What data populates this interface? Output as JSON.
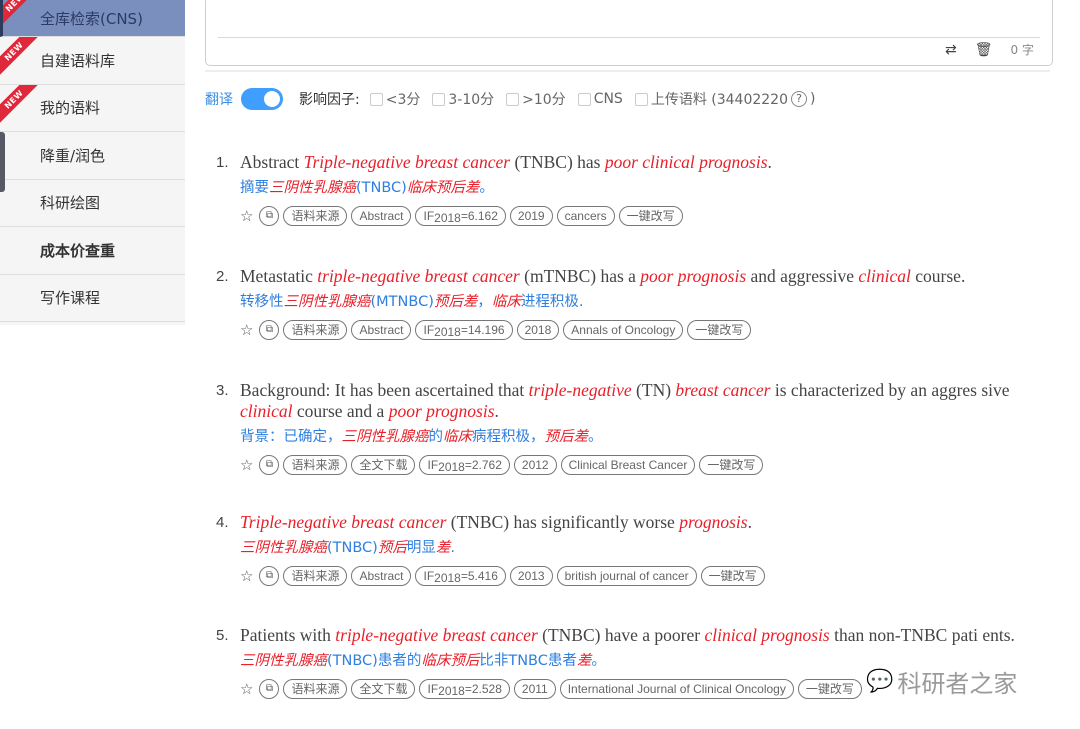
{
  "sidebar": {
    "items": [
      {
        "label": "全库检索(CNS)",
        "badge": "NEW",
        "active": true
      },
      {
        "label": "自建语料库",
        "badge": "NEW"
      },
      {
        "label": "我的语料",
        "badge": "NEW"
      },
      {
        "label": "降重/润色"
      },
      {
        "label": "科研绘图"
      },
      {
        "label": "成本价查重",
        "bold": true
      },
      {
        "label": "写作课程"
      }
    ]
  },
  "input": {
    "char_count": "0 字",
    "icons": [
      "swap-icon",
      "trash-icon"
    ]
  },
  "filter": {
    "translate_label": "翻译",
    "translate_on": true,
    "impact_factor_label": "影响因子:",
    "options": [
      {
        "label": "<3分",
        "checked": false
      },
      {
        "label": "3-10分",
        "checked": false
      },
      {
        "label": ">10分",
        "checked": false
      },
      {
        "label": "CNS",
        "checked": false
      },
      {
        "label": "上传语料 (34402220",
        "checked": false
      }
    ],
    "help_glyph": "?",
    "close_paren": ")"
  },
  "results": [
    {
      "num": "1.",
      "en": [
        {
          "t": "Abstract "
        },
        {
          "t": "Triple-negative breast cancer",
          "hl": true
        },
        {
          "t": " (TNBC) has "
        },
        {
          "t": "poor clinical prognosis",
          "hl": true
        },
        {
          "t": "."
        }
      ],
      "zh": [
        {
          "t": "摘要"
        },
        {
          "t": "三阴性乳腺癌",
          "hl": true
        },
        {
          "t": "(TNBC)"
        },
        {
          "t": "临床预后差",
          "hl": true
        },
        {
          "t": "。"
        }
      ],
      "tags": [
        "语料来源",
        "Abstract",
        "IF|2018|=6.162",
        "2019",
        "cancers",
        "一键改写"
      ]
    },
    {
      "num": "2.",
      "en": [
        {
          "t": "Metastatic "
        },
        {
          "t": "triple-negative breast cancer",
          "hl": true
        },
        {
          "t": " (mTNBC) has a "
        },
        {
          "t": "poor prognosis",
          "hl": true
        },
        {
          "t": " and aggressive "
        },
        {
          "t": "clinical",
          "hl": true
        },
        {
          "t": " course."
        }
      ],
      "zh": [
        {
          "t": "转移性"
        },
        {
          "t": "三阴性乳腺癌",
          "hl": true
        },
        {
          "t": "(MTNBC)"
        },
        {
          "t": "预后差",
          "hl": true
        },
        {
          "t": "，"
        },
        {
          "t": "临床",
          "hl": true
        },
        {
          "t": "进程积极."
        }
      ],
      "tags": [
        "语料来源",
        "Abstract",
        "IF|2018|=14.196",
        "2018",
        "Annals of Oncology",
        "一键改写"
      ]
    },
    {
      "num": "3.",
      "en": [
        {
          "t": "Background: It has been ascertained that "
        },
        {
          "t": "triple-negative",
          "hl": true
        },
        {
          "t": " (TN) "
        },
        {
          "t": "breast cancer",
          "hl": true
        },
        {
          "t": " is characterized by an aggres sive "
        },
        {
          "t": "clinical",
          "hl": true
        },
        {
          "t": " course and a "
        },
        {
          "t": "poor prognosis",
          "hl": true
        },
        {
          "t": "."
        }
      ],
      "zh": [
        {
          "t": "背景：已确定，"
        },
        {
          "t": "三阴性乳腺癌",
          "hl": true
        },
        {
          "t": "的"
        },
        {
          "t": "临床",
          "hl": true
        },
        {
          "t": "病程积极，"
        },
        {
          "t": "预后差",
          "hl": true
        },
        {
          "t": "。"
        }
      ],
      "tags": [
        "语料来源",
        "全文下载",
        "IF|2018|=2.762",
        "2012",
        "Clinical Breast Cancer",
        "一键改写"
      ]
    },
    {
      "num": "4.",
      "en": [
        {
          "t": "Triple-negative breast cancer",
          "hl": true
        },
        {
          "t": " (TNBC) has significantly worse "
        },
        {
          "t": "prognosis",
          "hl": true
        },
        {
          "t": "."
        }
      ],
      "zh": [
        {
          "t": "三阴性乳腺癌",
          "hl": true
        },
        {
          "t": "(TNBC)"
        },
        {
          "t": "预后",
          "hl": true
        },
        {
          "t": "明显"
        },
        {
          "t": "差",
          "hl": true
        },
        {
          "t": "."
        }
      ],
      "tags": [
        "语料来源",
        "Abstract",
        "IF|2018|=5.416",
        "2013",
        "british journal of cancer",
        "一键改写"
      ]
    },
    {
      "num": "5.",
      "en": [
        {
          "t": "Patients with "
        },
        {
          "t": "triple-negative breast cancer",
          "hl": true
        },
        {
          "t": " (TNBC) have a poorer "
        },
        {
          "t": "clinical prognosis",
          "hl": true
        },
        {
          "t": " than non-TNBC pati ents."
        }
      ],
      "zh": [
        {
          "t": "三阴性乳腺癌",
          "hl": true
        },
        {
          "t": "(TNBC)患者的"
        },
        {
          "t": "临床预后",
          "hl": true
        },
        {
          "t": "比非TNBC患者"
        },
        {
          "t": "差",
          "hl": true
        },
        {
          "t": "。"
        }
      ],
      "tags": [
        "语料来源",
        "全文下载",
        "IF|2018|=2.528",
        "2011",
        "International Journal of Clinical Oncology",
        "一键改写"
      ]
    }
  ],
  "watermark": "科研者之家"
}
